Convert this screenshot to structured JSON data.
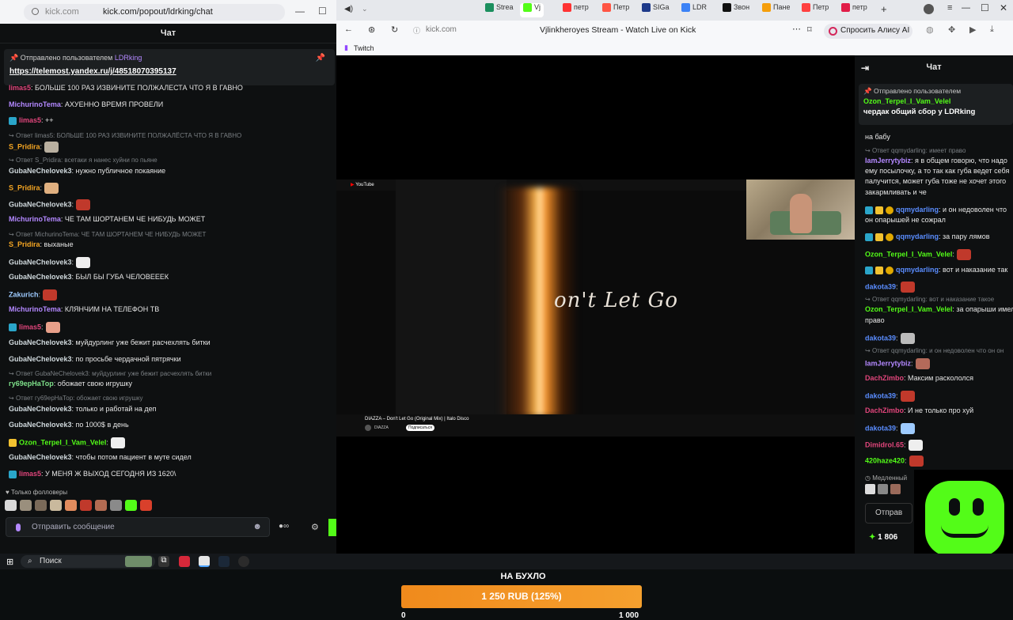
{
  "left_window": {
    "url_domain": "kick.com",
    "url_path": "kick.com/popout/ldrking/chat",
    "chat_title": "Чат",
    "pinned": {
      "sent_by": "Отправлено пользователем",
      "user": "LDRking",
      "link": "https://telemost.yandex.ru/j/48518070395137"
    },
    "messages": [
      {
        "nick": "limas5",
        "color": "#e0457b",
        "text": ": БОЛЬШЕ 100 РАЗ ИЗВИНИТЕ ПОЛЖАЛЕСТА ЧТО Я В ГАВНО"
      },
      {
        "nick": "MichurinoTema",
        "color": "#b388ff",
        "text": ": АХУЕННО ВРЕМЯ ПРОВЕЛИ"
      },
      {
        "nick": "limas5",
        "color": "#e0457b",
        "text": ": ++"
      },
      {
        "reply": "Ответ limas5: БОЛЬШЕ 100 РАЗ ИЗВИНИТЕ ПОЛЖАЛЁСТА ЧТО Я В ГАВНО"
      },
      {
        "nick": "S_Pridira",
        "color": "#f5a623",
        "text": ":"
      },
      {
        "reply": "Ответ S_Pridira: всетаки я нанес хуйни по пьяне"
      },
      {
        "nick": "GubaNeChelovek3",
        "color": "#cfd8dc",
        "text": ": нужно публичное покаяние"
      },
      {
        "nick": "S_Pridira",
        "color": "#f5a623",
        "text": ":"
      },
      {
        "nick": "GubaNeChelovek3",
        "color": "#cfd8dc",
        "text": ":"
      },
      {
        "nick": "MichurinoTema",
        "color": "#b388ff",
        "text": ": ЧЕ ТАМ ШОРТАНЕМ ЧЕ НИБУДЬ МОЖЕТ"
      },
      {
        "reply": "Ответ MichurinoTema: ЧЕ ТАМ ШОРТАНЕМ ЧЕ НИБУДЬ МОЖЕТ"
      },
      {
        "nick": "S_Pridira",
        "color": "#f5a623",
        "text": ": выханые"
      },
      {
        "nick": "GubaNeChelovek3",
        "color": "#cfd8dc",
        "text": ":"
      },
      {
        "nick": "GubaNeChelovek3",
        "color": "#cfd8dc",
        "text": ": БЫЛ БЫ ГУБА ЧЕЛОВЕЕЕК"
      },
      {
        "nick": "Zakurich",
        "color": "#9ecbff",
        "text": ":"
      },
      {
        "nick": "MichurinoTema",
        "color": "#b388ff",
        "text": ": КЛЯНЧИМ НА ТЕЛЕФОН ТВ"
      },
      {
        "nick": "limas5",
        "color": "#e0457b",
        "text": ":"
      },
      {
        "nick": "GubaNeChelovek3",
        "color": "#cfd8dc",
        "text": ": муйдурлинг уже бежит расчехлять битки"
      },
      {
        "nick": "GubaNeChelovek3",
        "color": "#cfd8dc",
        "text": ": по просьбе чердачной пятрячки"
      },
      {
        "reply": "Ответ GubaNeChelovek3: муйдурлинг уже бежит расчехлять битки"
      },
      {
        "nick": "гу69ерНаТор",
        "color": "#7ee08a",
        "text": ": обожает свою игрушку"
      },
      {
        "reply": "Ответ гу69ерНаТор: обожает свою игрушку"
      },
      {
        "nick": "GubaNeChelovek3",
        "color": "#cfd8dc",
        "text": ": только и работай на деп"
      },
      {
        "nick": "GubaNeChelovek3",
        "color": "#cfd8dc",
        "text": ": по 1000$ в день"
      },
      {
        "nick": "Ozon_Terpel_I_Vam_Velel",
        "color": "#53fc18",
        "text": ":"
      },
      {
        "nick": "GubaNeChelovek3",
        "color": "#cfd8dc",
        "text": ": чтобы потом пациент в муте сидел"
      },
      {
        "nick": "limas5",
        "color": "#e0457b",
        "text": ": У МЕНЯ Ж ВЫХОД СЕГОДНЯ ИЗ 1620\\"
      }
    ],
    "followers_only": "Только фолловеры",
    "input_placeholder": "Отправить сообщение"
  },
  "browser": {
    "tabs": [
      "Strea",
      "Vj",
      "петр",
      "Петр",
      "SIGa",
      "LDR",
      "Звон",
      "Пане",
      "Петр",
      "петр"
    ],
    "url_domain": "kick.com",
    "page_title": "Vjlinkheroyes Stream - Watch Live on Kick",
    "alice": "Спросить Алису AI",
    "bookmark": "Twitch"
  },
  "video": {
    "yt_brand": "YouTube",
    "overlay_text": "on't Let Go",
    "track_title": "DIAZZA – Don't Let Go (Original Mix) | Italo Disco",
    "channel": "DIAZZA",
    "subscribe": "Подписаться"
  },
  "goal": {
    "label": "НА БУХЛО",
    "value_text": "1 250 RUB (125%)",
    "min": "0",
    "max": "1 000",
    "percent": 125
  },
  "right_chat": {
    "title": "Чат",
    "pinned_sent_by": "Отправлено пользователем",
    "pinned_user": "Ozon_Terpel_I_Vam_Velel",
    "pinned_text": "чердак общий сбор у LDRking",
    "messages": [
      {
        "nick": "",
        "color": "#e6e6e6",
        "text": "на бабу"
      },
      {
        "reply": "Ответ qqmydarling: имеет право"
      },
      {
        "nick": "IamJerrytybiz",
        "color": "#b388ff",
        "text": ": я в общем говорю, что надо"
      },
      {
        "nick": "",
        "color": "#e6e6e6",
        "text": "ему посылочку, а то так как губа ведет себя"
      },
      {
        "nick": "",
        "color": "#e6e6e6",
        "text": "палучится, может губа тоже не хочет этого"
      },
      {
        "nick": "",
        "color": "#e6e6e6",
        "text": "закармливать и че"
      },
      {
        "nick": "qqmydarling",
        "color": "#5a8dff",
        "text": ": и он недоволен что"
      },
      {
        "nick": "",
        "color": "#e6e6e6",
        "text": "он опарышей не сожрал"
      },
      {
        "nick": "qqmydarling",
        "color": "#5a8dff",
        "text": ": за пару лямов"
      },
      {
        "nick": "Ozon_Terpel_I_Vam_Velel",
        "color": "#53fc18",
        "text": ":"
      },
      {
        "nick": "qqmydarling",
        "color": "#5a8dff",
        "text": ": вот и наказание так"
      },
      {
        "nick": "dakota39",
        "color": "#5a8dff",
        "text": ":"
      },
      {
        "reply": "Ответ qqmydarling: вот и наказание такое"
      },
      {
        "nick": "Ozon_Terpel_I_Vam_Velel",
        "color": "#53fc18",
        "text": ": за опарыши имел"
      },
      {
        "nick": "",
        "color": "#e6e6e6",
        "text": "право"
      },
      {
        "nick": "dakota39",
        "color": "#5a8dff",
        "text": ":"
      },
      {
        "reply": "Ответ qqmydarling: и он недоволен что он он"
      },
      {
        "nick": "IamJerrytybiz",
        "color": "#b388ff",
        "text": ":"
      },
      {
        "nick": "DachZimbo",
        "color": "#e0457b",
        "text": ": Максим раскололся"
      },
      {
        "nick": "dakota39",
        "color": "#5a8dff",
        "text": ":"
      },
      {
        "nick": "DachZimbo",
        "color": "#e0457b",
        "text": ": И не только про хуй"
      },
      {
        "nick": "dakota39",
        "color": "#5a8dff",
        "text": ":"
      },
      {
        "nick": "Dimidrol.65",
        "color": "#e0457b",
        "text": ":"
      },
      {
        "nick": "420haze420",
        "color": "#53fc18",
        "text": ":"
      }
    ],
    "slow_mode": "Медленный",
    "send_btn": "Отправ",
    "points": "1 806"
  },
  "taskbar": {
    "search": "Поиск"
  }
}
